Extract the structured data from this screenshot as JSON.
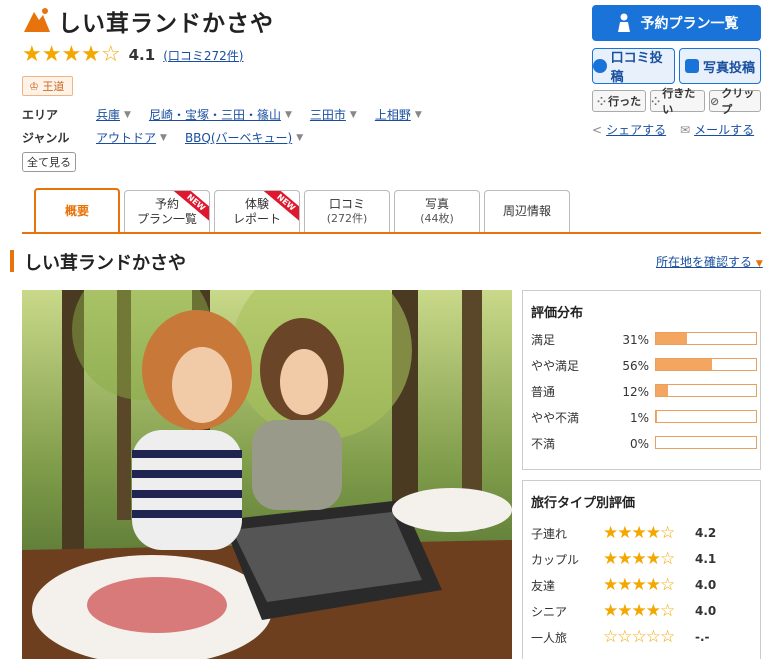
{
  "header": {
    "title": "しい茸ランドかさや",
    "stars": "★★★★☆",
    "rating": "4.1",
    "reviews_link": "(口コミ272件)",
    "badge": "王道"
  },
  "area": {
    "label": "エリア",
    "items": [
      "兵庫",
      "尼崎・宝塚・三田・篠山",
      "三田市",
      "上相野"
    ]
  },
  "genre": {
    "label": "ジャンル",
    "items": [
      "アウトドア",
      "BBQ(バーベキュー)"
    ]
  },
  "show_all": "全て見る",
  "actions": {
    "plan_list": "予約プラン一覧",
    "post_review": "口コミ投稿",
    "post_photo": "写真投稿",
    "went": "行った",
    "want_to_go": "行きたい",
    "clip": "クリップ",
    "share": "シェアする",
    "mail": "メールする"
  },
  "tabs": [
    {
      "label": "概要",
      "sub": ""
    },
    {
      "label": "予約",
      "sub": "プラン一覧",
      "badge": "NEW"
    },
    {
      "label": "体験",
      "sub": "レポート",
      "badge": "NEW"
    },
    {
      "label": "口コミ",
      "sub": "(272件)"
    },
    {
      "label": "写真",
      "sub": "(44枚)"
    },
    {
      "label": "周辺情報",
      "sub": ""
    }
  ],
  "section": {
    "title": "しい茸ランドかさや",
    "location_link": "所在地を確認する"
  },
  "rating_distribution": {
    "title": "評価分布",
    "rows": [
      {
        "label": "満足",
        "pct": "31%",
        "value": 31
      },
      {
        "label": "やや満足",
        "pct": "56%",
        "value": 56
      },
      {
        "label": "普通",
        "pct": "12%",
        "value": 12
      },
      {
        "label": "やや不満",
        "pct": "1%",
        "value": 1
      },
      {
        "label": "不満",
        "pct": "0%",
        "value": 0
      }
    ]
  },
  "trip_type": {
    "title": "旅行タイプ別評価",
    "rows": [
      {
        "label": "子連れ",
        "stars": "★★★★☆",
        "value": "4.2"
      },
      {
        "label": "カップル",
        "stars": "★★★★☆",
        "value": "4.1"
      },
      {
        "label": "友達",
        "stars": "★★★★☆",
        "value": "4.0"
      },
      {
        "label": "シニア",
        "stars": "★★★★☆",
        "value": "4.0"
      },
      {
        "label": "一人旅",
        "stars": "☆☆☆☆☆",
        "value": "-.-"
      }
    ]
  },
  "colors": {
    "accent": "#e8730c",
    "link": "#1a4fa0",
    "primary_button": "#1a73d8",
    "star": "#f2a800"
  }
}
